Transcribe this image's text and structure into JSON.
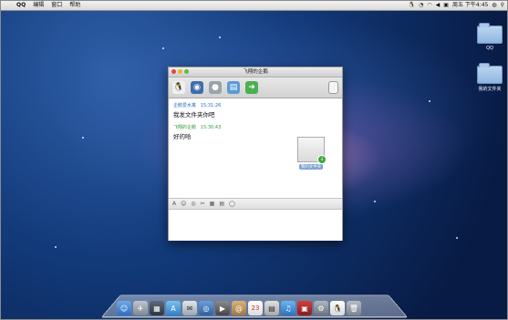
{
  "menubar": {
    "app_name": "QQ",
    "items": [
      "编辑",
      "窗口",
      "帮助"
    ],
    "clock": "周五 下午4:45"
  },
  "desktop": {
    "icons": [
      {
        "label": "QQ"
      },
      {
        "label": "我的文件夹"
      }
    ]
  },
  "chat_window": {
    "title": "飞翔的企鹅",
    "messages": [
      {
        "sender": "企鹅爱水禽",
        "time": "15:31:26",
        "text": "我发文件夹你吧"
      },
      {
        "sender": "飞翔的企鹅",
        "time": "15:30:43",
        "text": "好的哈"
      }
    ],
    "file": {
      "label": "我的文件夹"
    }
  },
  "colors": {
    "sender_blue": "#2a6cc0",
    "sender_green": "#2e9a38",
    "menubar_bg": "#e6e6e6"
  }
}
